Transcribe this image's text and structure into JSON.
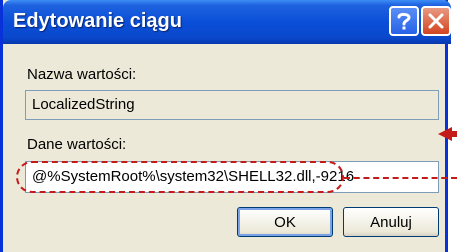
{
  "window": {
    "title": "Edytowanie ciągu",
    "help_icon": "question-mark-icon",
    "close_icon": "close-x-icon"
  },
  "form": {
    "value_name_label": "Nazwa wartości:",
    "value_name": "LocalizedString",
    "value_data_label": "Dane wartości:",
    "value_data": "@%SystemRoot%\\system32\\SHELL32.dll,-9216"
  },
  "buttons": {
    "ok": "OK",
    "cancel": "Anuluj"
  },
  "colors": {
    "titlebar": "#0a4fd8",
    "annotation": "#c41a1a",
    "dialog_bg": "#ece9d8"
  }
}
